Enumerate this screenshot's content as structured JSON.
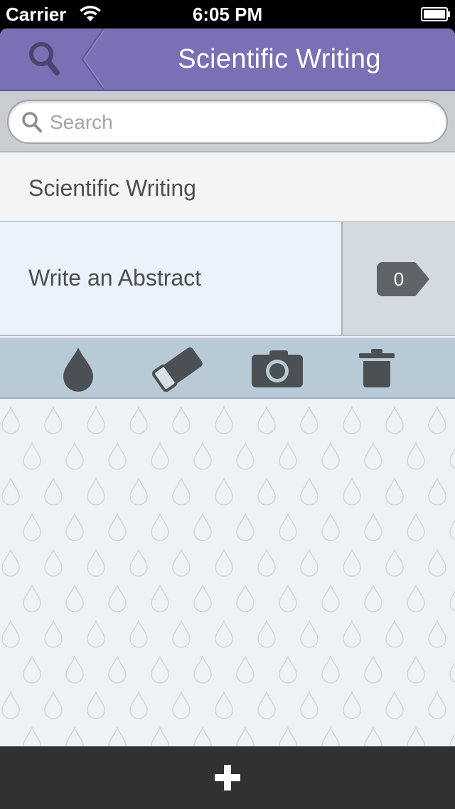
{
  "status_bar": {
    "carrier": "Carrier",
    "time": "6:05 PM",
    "wifi_icon": "wifi-icon",
    "battery_icon": "battery-icon"
  },
  "nav": {
    "title": "Scientific Writing",
    "search_icon": "search-icon",
    "color": "#7a70b4"
  },
  "search": {
    "placeholder": "Search",
    "value": ""
  },
  "list": {
    "section_title": "Scientific Writing",
    "item_title": "Write an Abstract",
    "item_count": "0"
  },
  "toolbar": {
    "icons": [
      "drop-icon",
      "eraser-icon",
      "camera-icon",
      "trash-icon"
    ]
  },
  "bottom_bar": {
    "add_icon": "plus-icon"
  }
}
